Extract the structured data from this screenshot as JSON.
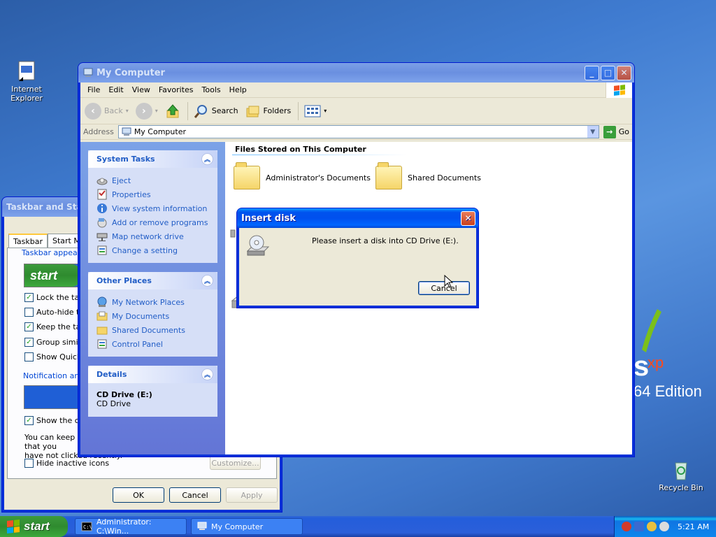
{
  "desktop": {
    "icons": [
      {
        "label_line1": "Internet",
        "label_line2": "Explorer",
        "icon": "internet-explorer-shortcut-icon"
      },
      {
        "label": "Recycle Bin",
        "icon": "recycle-bin-icon"
      }
    ],
    "wallpaper_text": {
      "mark": "s",
      "xp": "xp",
      "edition": "64 Edition"
    }
  },
  "taskbar_props": {
    "title": "Taskbar and Start Menu Properties",
    "tabs": [
      "Taskbar",
      "Start Menu"
    ],
    "group1_label": "Taskbar appearance",
    "start_preview": "start",
    "options": [
      {
        "label": "Lock the taskbar",
        "checked": true
      },
      {
        "label": "Auto-hide the taskbar",
        "checked": false
      },
      {
        "label": "Keep the taskbar on top of other windows",
        "checked": true
      },
      {
        "label": "Group similar taskbar buttons",
        "checked": true
      },
      {
        "label": "Show Quick Launch",
        "checked": false
      }
    ],
    "group2_label": "Notification area",
    "show_clock": {
      "label": "Show the clock",
      "checked": true
    },
    "info_line1": "You can keep the notification area uncluttered by hiding icons that you",
    "info_line2": "have not clicked recently.",
    "hide_inactive": {
      "label": "Hide inactive icons",
      "checked": false
    },
    "customize": "Customize...",
    "ok": "OK",
    "cancel": "Cancel",
    "apply": "Apply"
  },
  "mycomputer": {
    "title": "My Computer",
    "menu": [
      "File",
      "Edit",
      "View",
      "Favorites",
      "Tools",
      "Help"
    ],
    "toolbar": {
      "back": "Back",
      "search": "Search",
      "folders": "Folders"
    },
    "address_label": "Address",
    "address_value": "My Computer",
    "go": "Go",
    "system_tasks": {
      "title": "System Tasks",
      "items": [
        "Eject",
        "Properties",
        "View system information",
        "Add or remove programs",
        "Map network drive",
        "Change a setting"
      ]
    },
    "other_places": {
      "title": "Other Places",
      "items": [
        "My Network Places",
        "My Documents",
        "Shared Documents",
        "Control Panel"
      ]
    },
    "details": {
      "title": "Details",
      "name": "CD Drive (E:)",
      "type": "CD Drive"
    },
    "section_title": "Files Stored on This Computer",
    "folders": [
      "Administrator's Documents",
      "Shared Documents"
    ]
  },
  "dialog": {
    "title": "Insert disk",
    "message": "Please insert a disk into CD Drive (E:).",
    "cancel": "Cancel"
  },
  "taskbar": {
    "start": "start",
    "items": [
      "Administrator: C:\\Win...",
      "My Computer"
    ],
    "clock": "5:21 AM"
  }
}
